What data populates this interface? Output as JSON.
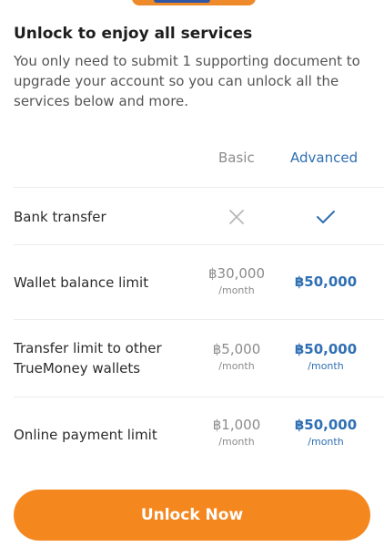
{
  "title": "Unlock to enjoy all services",
  "description": "You only need to submit 1 supporting document to upgrade your account so you can unlock all the services below and more.",
  "columns": {
    "basic": "Basic",
    "advanced": "Advanced"
  },
  "rows": [
    {
      "label": "Bank transfer",
      "basic_icon": "cross-icon",
      "advanced_icon": "check-icon"
    },
    {
      "label": "Wallet balance limit",
      "basic_value": "฿30,000",
      "basic_unit": "/month",
      "advanced_value": "฿50,000"
    },
    {
      "label": "Transfer limit to other TrueMoney wallets",
      "basic_value": "฿5,000",
      "basic_unit": "/month",
      "advanced_value": "฿50,000",
      "advanced_unit": "/month"
    },
    {
      "label": "Online payment limit",
      "basic_value": "฿1,000",
      "basic_unit": "/month",
      "advanced_value": "฿50,000",
      "advanced_unit": "/month"
    }
  ],
  "button": {
    "label": "Unlock Now"
  },
  "colors": {
    "accent": "#f5871f",
    "advanced": "#2f6fb3",
    "muted": "#8b8b8b"
  }
}
